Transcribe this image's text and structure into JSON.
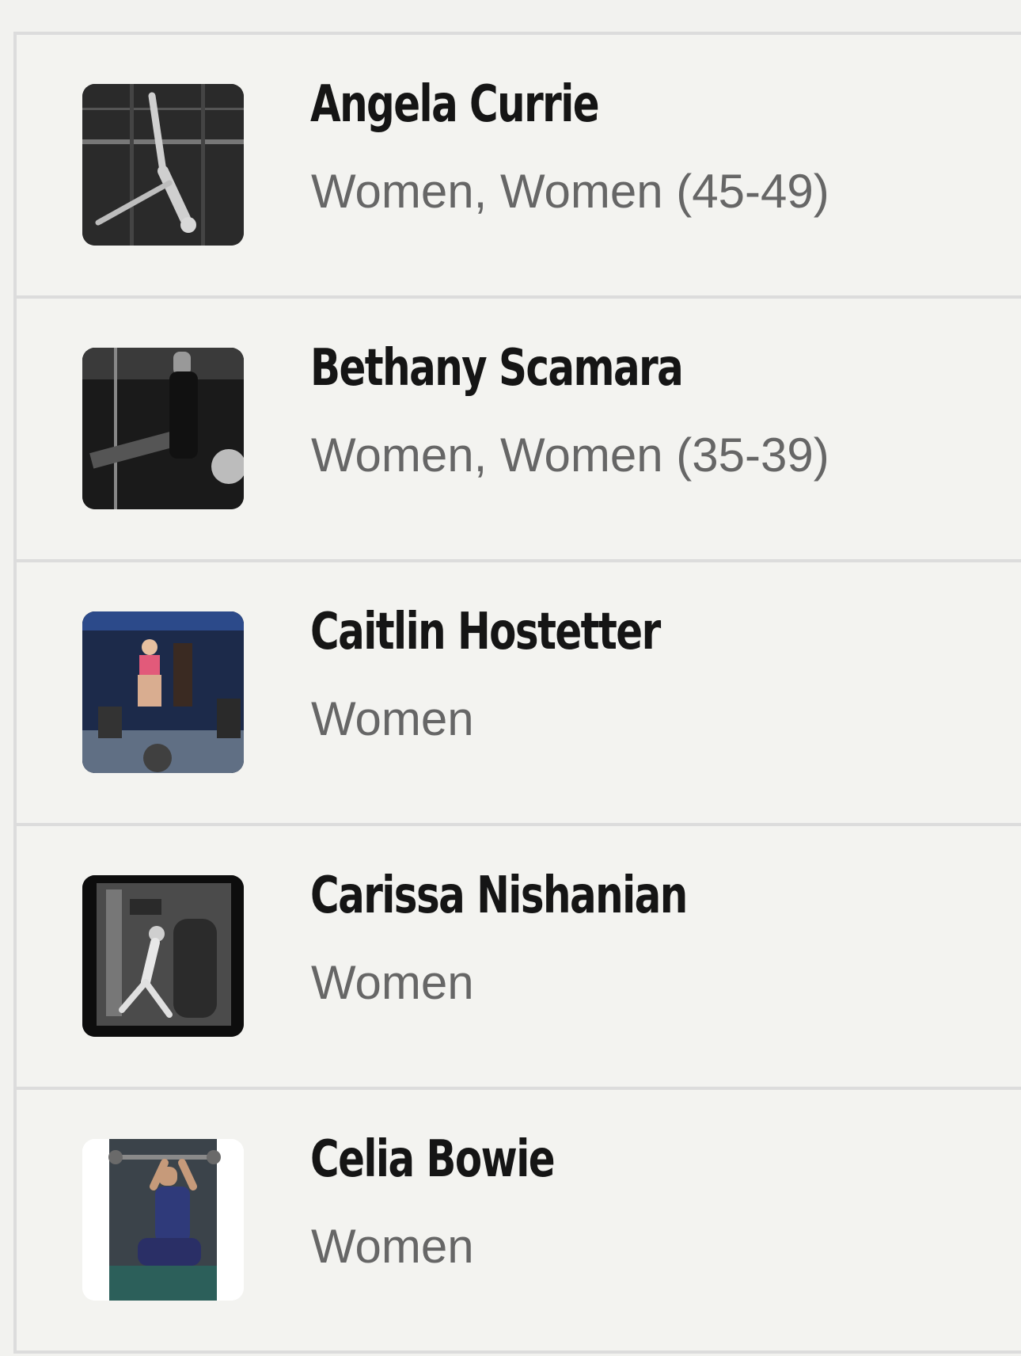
{
  "athletes": [
    {
      "name": "Angela Currie",
      "division": "Women, Women (45-49)",
      "photo_icon": "athlete-photo"
    },
    {
      "name": "Bethany Scamara",
      "division": "Women, Women (35-39)",
      "photo_icon": "athlete-photo"
    },
    {
      "name": "Caitlin Hostetter",
      "division": "Women",
      "photo_icon": "athlete-photo"
    },
    {
      "name": "Carissa Nishanian",
      "division": "Women",
      "photo_icon": "athlete-photo"
    },
    {
      "name": "Celia Bowie",
      "division": "Women",
      "photo_icon": "athlete-photo"
    }
  ]
}
